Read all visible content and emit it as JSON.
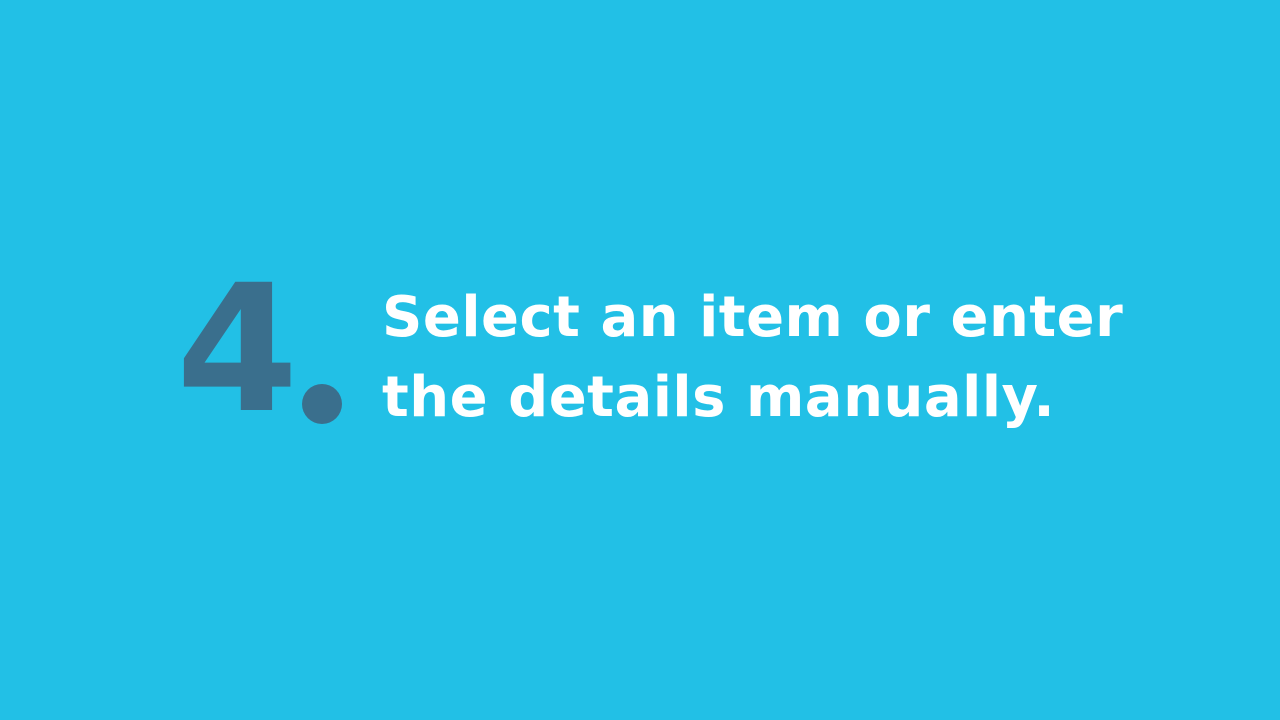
{
  "step": {
    "number": "4",
    "line1": "Select an item or enter",
    "line2": "the details manually."
  },
  "colors": {
    "background": "#22c0e6",
    "number": "#3a6f8d",
    "text": "#ffffff"
  }
}
